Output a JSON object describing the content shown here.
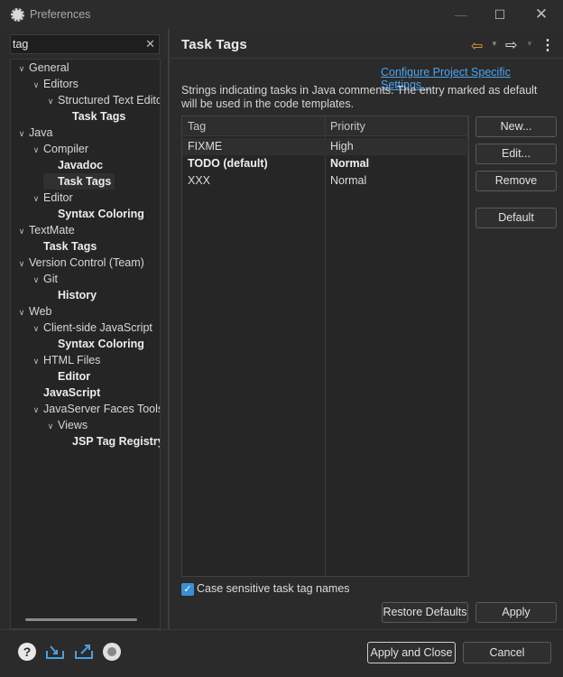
{
  "window": {
    "title": "Preferences",
    "min_label": "—",
    "max_label": "☐",
    "close_label": "✕"
  },
  "search": {
    "value": "tag",
    "clear_label": "✕"
  },
  "tree": [
    {
      "label": "General",
      "level": 0,
      "expanded": true,
      "bold": false
    },
    {
      "label": "Editors",
      "level": 1,
      "expanded": true,
      "bold": false
    },
    {
      "label": "Structured Text Edito",
      "level": 2,
      "expanded": true,
      "bold": false
    },
    {
      "label": "Task Tags",
      "level": 3,
      "expanded": null,
      "bold": true
    },
    {
      "label": "Java",
      "level": 0,
      "expanded": true,
      "bold": false
    },
    {
      "label": "Compiler",
      "level": 1,
      "expanded": true,
      "bold": false
    },
    {
      "label": "Javadoc",
      "level": 2,
      "expanded": null,
      "bold": true
    },
    {
      "label": "Task Tags",
      "level": 2,
      "expanded": null,
      "bold": true,
      "selected": true
    },
    {
      "label": "Editor",
      "level": 1,
      "expanded": true,
      "bold": false
    },
    {
      "label": "Syntax Coloring",
      "level": 2,
      "expanded": null,
      "bold": true
    },
    {
      "label": "TextMate",
      "level": 0,
      "expanded": true,
      "bold": false
    },
    {
      "label": "Task Tags",
      "level": 1,
      "expanded": null,
      "bold": true
    },
    {
      "label": "Version Control (Team)",
      "level": 0,
      "expanded": true,
      "bold": false
    },
    {
      "label": "Git",
      "level": 1,
      "expanded": true,
      "bold": false
    },
    {
      "label": "History",
      "level": 2,
      "expanded": null,
      "bold": true
    },
    {
      "label": "Web",
      "level": 0,
      "expanded": true,
      "bold": false
    },
    {
      "label": "Client-side JavaScript",
      "level": 1,
      "expanded": true,
      "bold": false
    },
    {
      "label": "Syntax Coloring",
      "level": 2,
      "expanded": null,
      "bold": true
    },
    {
      "label": "HTML Files",
      "level": 1,
      "expanded": true,
      "bold": false
    },
    {
      "label": "Editor",
      "level": 2,
      "expanded": null,
      "bold": true
    },
    {
      "label": "JavaScript",
      "level": 1,
      "expanded": null,
      "bold": true
    },
    {
      "label": "JavaServer Faces Tools",
      "level": 1,
      "expanded": true,
      "bold": false
    },
    {
      "label": "Views",
      "level": 2,
      "expanded": true,
      "bold": false
    },
    {
      "label": "JSP Tag Registry",
      "level": 3,
      "expanded": null,
      "bold": true
    }
  ],
  "page": {
    "title": "Task Tags",
    "configure_link": "Configure Project Specific Settings...",
    "description": "Strings indicating tasks in Java comments. The entry marked as default will be used in the code templates."
  },
  "table": {
    "columns": [
      "Tag",
      "Priority"
    ],
    "rows": [
      {
        "tag": "FIXME",
        "priority": "High",
        "default": false
      },
      {
        "tag": "TODO (default)",
        "priority": "Normal",
        "default": true
      },
      {
        "tag": "XXX",
        "priority": "Normal",
        "default": false
      }
    ]
  },
  "buttons": {
    "new": "New...",
    "edit": "Edit...",
    "remove": "Remove",
    "default": "Default",
    "restore_defaults": "Restore Defaults",
    "apply": "Apply",
    "apply_close": "Apply and Close",
    "cancel": "Cancel"
  },
  "options": {
    "case_sensitive_label": "Case sensitive task tag names",
    "case_sensitive_checked": true
  },
  "icons": {
    "nav_back": "arrow-left-icon",
    "nav_forward": "arrow-right-icon",
    "menu": "more-vertical-icon",
    "help": "help-icon",
    "import": "import-icon",
    "export": "export-icon",
    "oomph": "oomph-icon"
  },
  "colors": {
    "link": "#4aa3f0",
    "back_arrow": "#e6a13c",
    "checkbox": "#3b8fd6"
  }
}
